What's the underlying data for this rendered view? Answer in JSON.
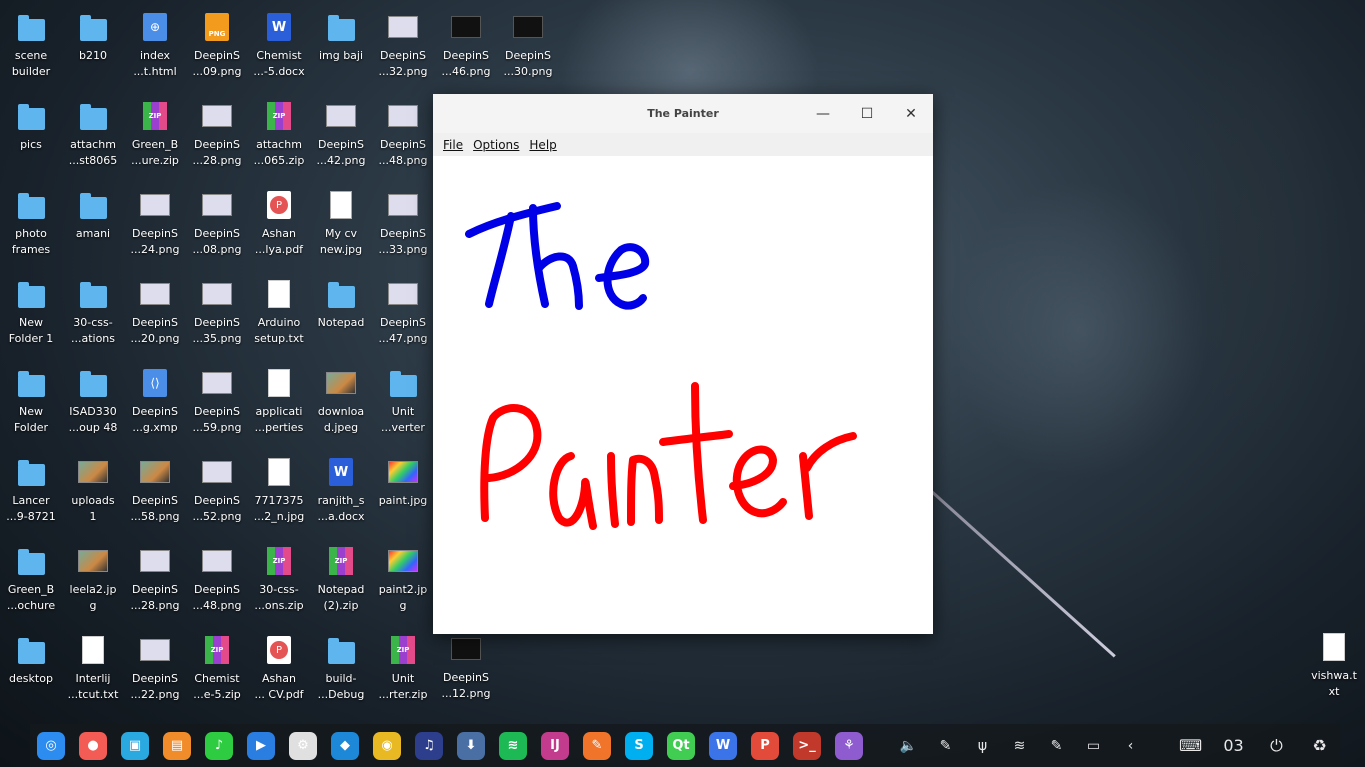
{
  "desktop_icons": [
    {
      "label": "scene\nbuilder",
      "icon": "folder-icon"
    },
    {
      "label": "b210",
      "icon": "folder-icon"
    },
    {
      "label": "index\n...t.html",
      "icon": "html-file-icon"
    },
    {
      "label": "DeepinS\n...09.png",
      "icon": "png-file-icon"
    },
    {
      "label": "Chemist\n...-5.docx",
      "icon": "word-doc-icon"
    },
    {
      "label": "img baji",
      "icon": "folder-icon"
    },
    {
      "label": "DeepinS\n...32.png",
      "icon": "screenshot-thumb-icon"
    },
    {
      "label": "pics",
      "icon": "folder-icon"
    },
    {
      "label": "attachm\n...st8065",
      "icon": "folder-icon"
    },
    {
      "label": "Green_B\n...ure.zip",
      "icon": "zip-archive-icon"
    },
    {
      "label": "DeepinS\n...28.png",
      "icon": "screenshot-thumb-icon"
    },
    {
      "label": "attachm\n...065.zip",
      "icon": "zip-archive-icon"
    },
    {
      "label": "DeepinS\n...42.png",
      "icon": "screenshot-thumb-icon"
    },
    {
      "label": "DeepinS\n...48.png",
      "icon": "screenshot-thumb-icon"
    },
    {
      "label": "photo\nframes",
      "icon": "folder-icon"
    },
    {
      "label": "amani",
      "icon": "folder-icon"
    },
    {
      "label": "DeepinS\n...24.png",
      "icon": "screenshot-thumb-icon"
    },
    {
      "label": "DeepinS\n...08.png",
      "icon": "screenshot-thumb-icon"
    },
    {
      "label": "Ashan\n...lya.pdf",
      "icon": "pdf-file-icon"
    },
    {
      "label": "My cv\nnew.jpg",
      "icon": "document-thumb-icon"
    },
    {
      "label": "DeepinS\n...33.png",
      "icon": "screenshot-thumb-icon"
    },
    {
      "label": "New\nFolder 1",
      "icon": "folder-icon"
    },
    {
      "label": "30-css-\n...ations",
      "icon": "folder-icon"
    },
    {
      "label": "DeepinS\n...20.png",
      "icon": "screenshot-thumb-icon"
    },
    {
      "label": "DeepinS\n...35.png",
      "icon": "screenshot-thumb-icon"
    },
    {
      "label": "Arduino\nsetup.txt",
      "icon": "text-file-icon"
    },
    {
      "label": "Notepad",
      "icon": "folder-icon"
    },
    {
      "label": "DeepinS\n...47.png",
      "icon": "screenshot-thumb-icon"
    },
    {
      "label": "New\nFolder",
      "icon": "folder-icon"
    },
    {
      "label": "ISAD330\n...oup 48",
      "icon": "folder-icon"
    },
    {
      "label": "DeepinS\n...g.xmp",
      "icon": "xmp-file-icon"
    },
    {
      "label": "DeepinS\n...59.png",
      "icon": "screenshot-thumb-icon"
    },
    {
      "label": "applicati\n...perties",
      "icon": "text-file-icon"
    },
    {
      "label": "downloa\nd.jpeg",
      "icon": "photo-thumb-icon"
    },
    {
      "label": "Unit\n...verter",
      "icon": "folder-icon"
    },
    {
      "label": "Lancer\n...9-8721",
      "icon": "folder-icon"
    },
    {
      "label": "uploads\n1",
      "icon": "photo-thumb-icon"
    },
    {
      "label": "DeepinS\n...58.png",
      "icon": "photo-thumb-icon"
    },
    {
      "label": "DeepinS\n...52.png",
      "icon": "screenshot-thumb-icon"
    },
    {
      "label": "7717375\n...2_n.jpg",
      "icon": "document-thumb-icon"
    },
    {
      "label": "ranjith_s\n...a.docx",
      "icon": "word-doc-icon"
    },
    {
      "label": "paint.jpg",
      "icon": "rainbow-thumb-icon"
    },
    {
      "label": "Green_B\n...ochure",
      "icon": "folder-icon"
    },
    {
      "label": "leela2.jp\ng",
      "icon": "photo-thumb-icon"
    },
    {
      "label": "DeepinS\n...28.png",
      "icon": "screenshot-thumb-icon"
    },
    {
      "label": "DeepinS\n...48.png",
      "icon": "screenshot-thumb-icon"
    },
    {
      "label": "30-css-\n...ons.zip",
      "icon": "zip-archive-icon"
    },
    {
      "label": "Notepad\n(2).zip",
      "icon": "zip-archive-icon"
    },
    {
      "label": "paint2.jp\ng",
      "icon": "rainbow-thumb-icon"
    },
    {
      "label": "desktop",
      "icon": "folder-icon"
    },
    {
      "label": "Interlij\n...tcut.txt",
      "icon": "text-file-icon"
    },
    {
      "label": "DeepinS\n...22.png",
      "icon": "screenshot-thumb-icon"
    },
    {
      "label": "Chemist\n...e-5.zip",
      "icon": "zip-archive-icon"
    },
    {
      "label": "Ashan\n... CV.pdf",
      "icon": "pdf-file-icon"
    },
    {
      "label": "build-\n...Debug",
      "icon": "folder-icon"
    },
    {
      "label": "Unit\n...rter.zip",
      "icon": "zip-archive-icon"
    }
  ],
  "extra_icons": [
    {
      "label": "DeepinS\n...46.png",
      "icon": "screenshot-thumb-icon"
    },
    {
      "label": "DeepinS\n...30.png",
      "icon": "screenshot-thumb-icon"
    },
    {
      "label": "DeepinS\n...12.png",
      "icon": "screenshot-thumb-icon"
    }
  ],
  "lone_icon": {
    "label": "vishwa.t\nxt",
    "icon": "text-file-icon"
  },
  "window": {
    "title": "The Painter",
    "menu": [
      "File",
      "Options",
      "Help"
    ],
    "minimize_glyph": "—",
    "maximize_glyph": "☐",
    "close_glyph": "✕"
  },
  "colors": {
    "ink_blue": "#0000e6",
    "ink_red": "#ff0000",
    "dock_bg": "#14181c"
  },
  "dock": {
    "apps": [
      {
        "name": "launcher",
        "color": "#2d8cf0",
        "glyph": "◎"
      },
      {
        "name": "screen-recorder",
        "color": "#f25c54",
        "glyph": "●"
      },
      {
        "name": "app-store",
        "color": "#2aa8e0",
        "glyph": "▣"
      },
      {
        "name": "archive-manager",
        "color": "#f08c2a",
        "glyph": "▤"
      },
      {
        "name": "music",
        "color": "#2ecc40",
        "glyph": "♪"
      },
      {
        "name": "movie",
        "color": "#2a7de1",
        "glyph": "▶"
      },
      {
        "name": "settings",
        "color": "#e0e0e0",
        "glyph": "⚙"
      },
      {
        "name": "vscode",
        "color": "#1e88d8",
        "glyph": "◆"
      },
      {
        "name": "chrome",
        "color": "#e8b923",
        "glyph": "◉"
      },
      {
        "name": "headphones",
        "color": "#2c3e8c",
        "glyph": "♫"
      },
      {
        "name": "usb-creator",
        "color": "#4a6fa5",
        "glyph": "⬇"
      },
      {
        "name": "spotify",
        "color": "#1db954",
        "glyph": "≋"
      },
      {
        "name": "intellij",
        "color": "#c33b8c",
        "glyph": "IJ"
      },
      {
        "name": "paint",
        "color": "#f0742a",
        "glyph": "✎"
      },
      {
        "name": "skype",
        "color": "#00aff0",
        "glyph": "S"
      },
      {
        "name": "qt-creator",
        "color": "#41cd52",
        "glyph": "Qt"
      },
      {
        "name": "wps-writer",
        "color": "#3a74e8",
        "glyph": "W"
      },
      {
        "name": "wps-pdf",
        "color": "#e24a3a",
        "glyph": "P"
      },
      {
        "name": "terminal",
        "color": "#c0392b",
        "glyph": ">_"
      },
      {
        "name": "plugin",
        "color": "#8e5ccf",
        "glyph": "⚘"
      }
    ],
    "tray": [
      {
        "name": "volume",
        "glyph": "🔈"
      },
      {
        "name": "edit",
        "glyph": "✎"
      },
      {
        "name": "usb",
        "glyph": "ψ"
      },
      {
        "name": "wifi",
        "glyph": "≋"
      },
      {
        "name": "edit-2",
        "glyph": "✎"
      },
      {
        "name": "battery",
        "glyph": "▭"
      },
      {
        "name": "chevron-left",
        "glyph": "‹"
      }
    ],
    "extras": [
      {
        "name": "keyboard",
        "glyph": "⌨"
      },
      {
        "name": "clock",
        "glyph": "03"
      },
      {
        "name": "power",
        "glyph": "⏻"
      },
      {
        "name": "trash",
        "glyph": "♻"
      }
    ]
  }
}
